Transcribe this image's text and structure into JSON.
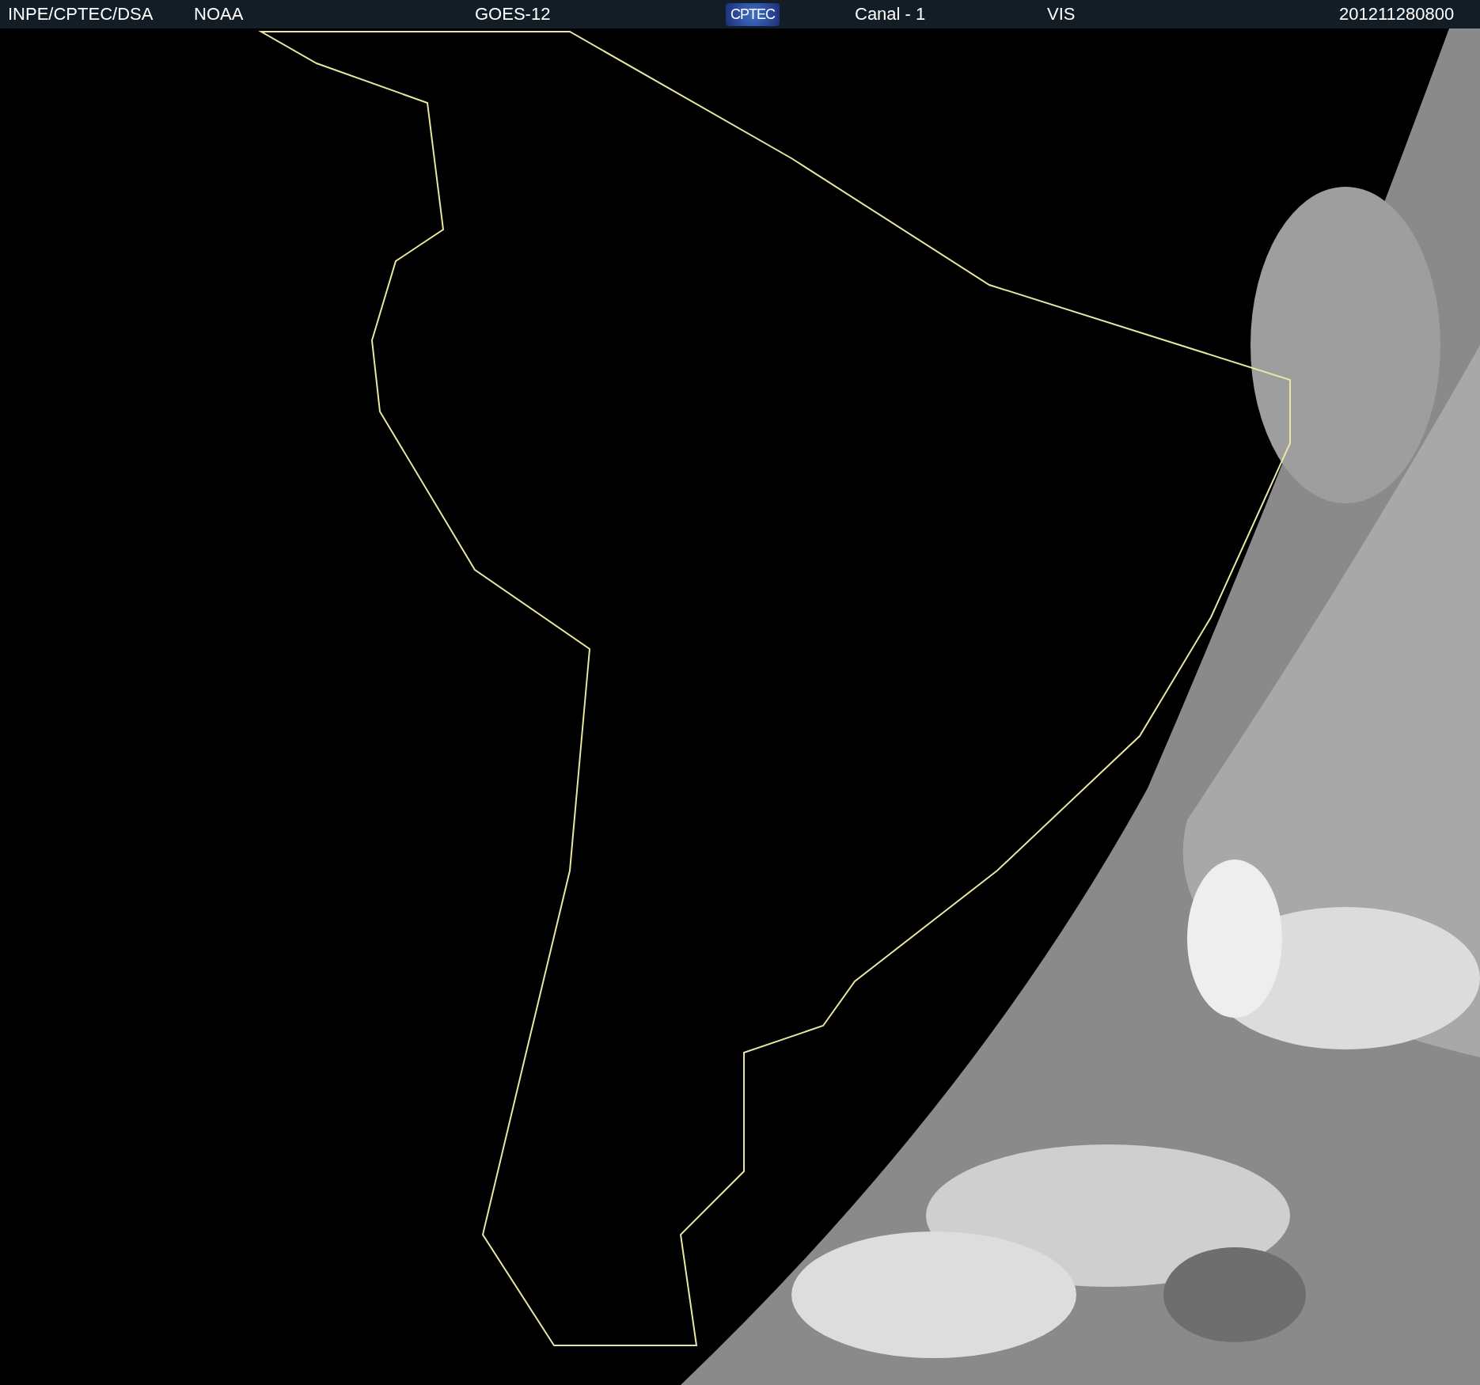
{
  "header": {
    "source": "INPE/CPTEC/DSA",
    "agency": "NOAA",
    "satellite": "GOES-12",
    "logo": "CPTEC",
    "channel": "Canal - 1",
    "band": "VIS",
    "timestamp": "201211280800"
  }
}
